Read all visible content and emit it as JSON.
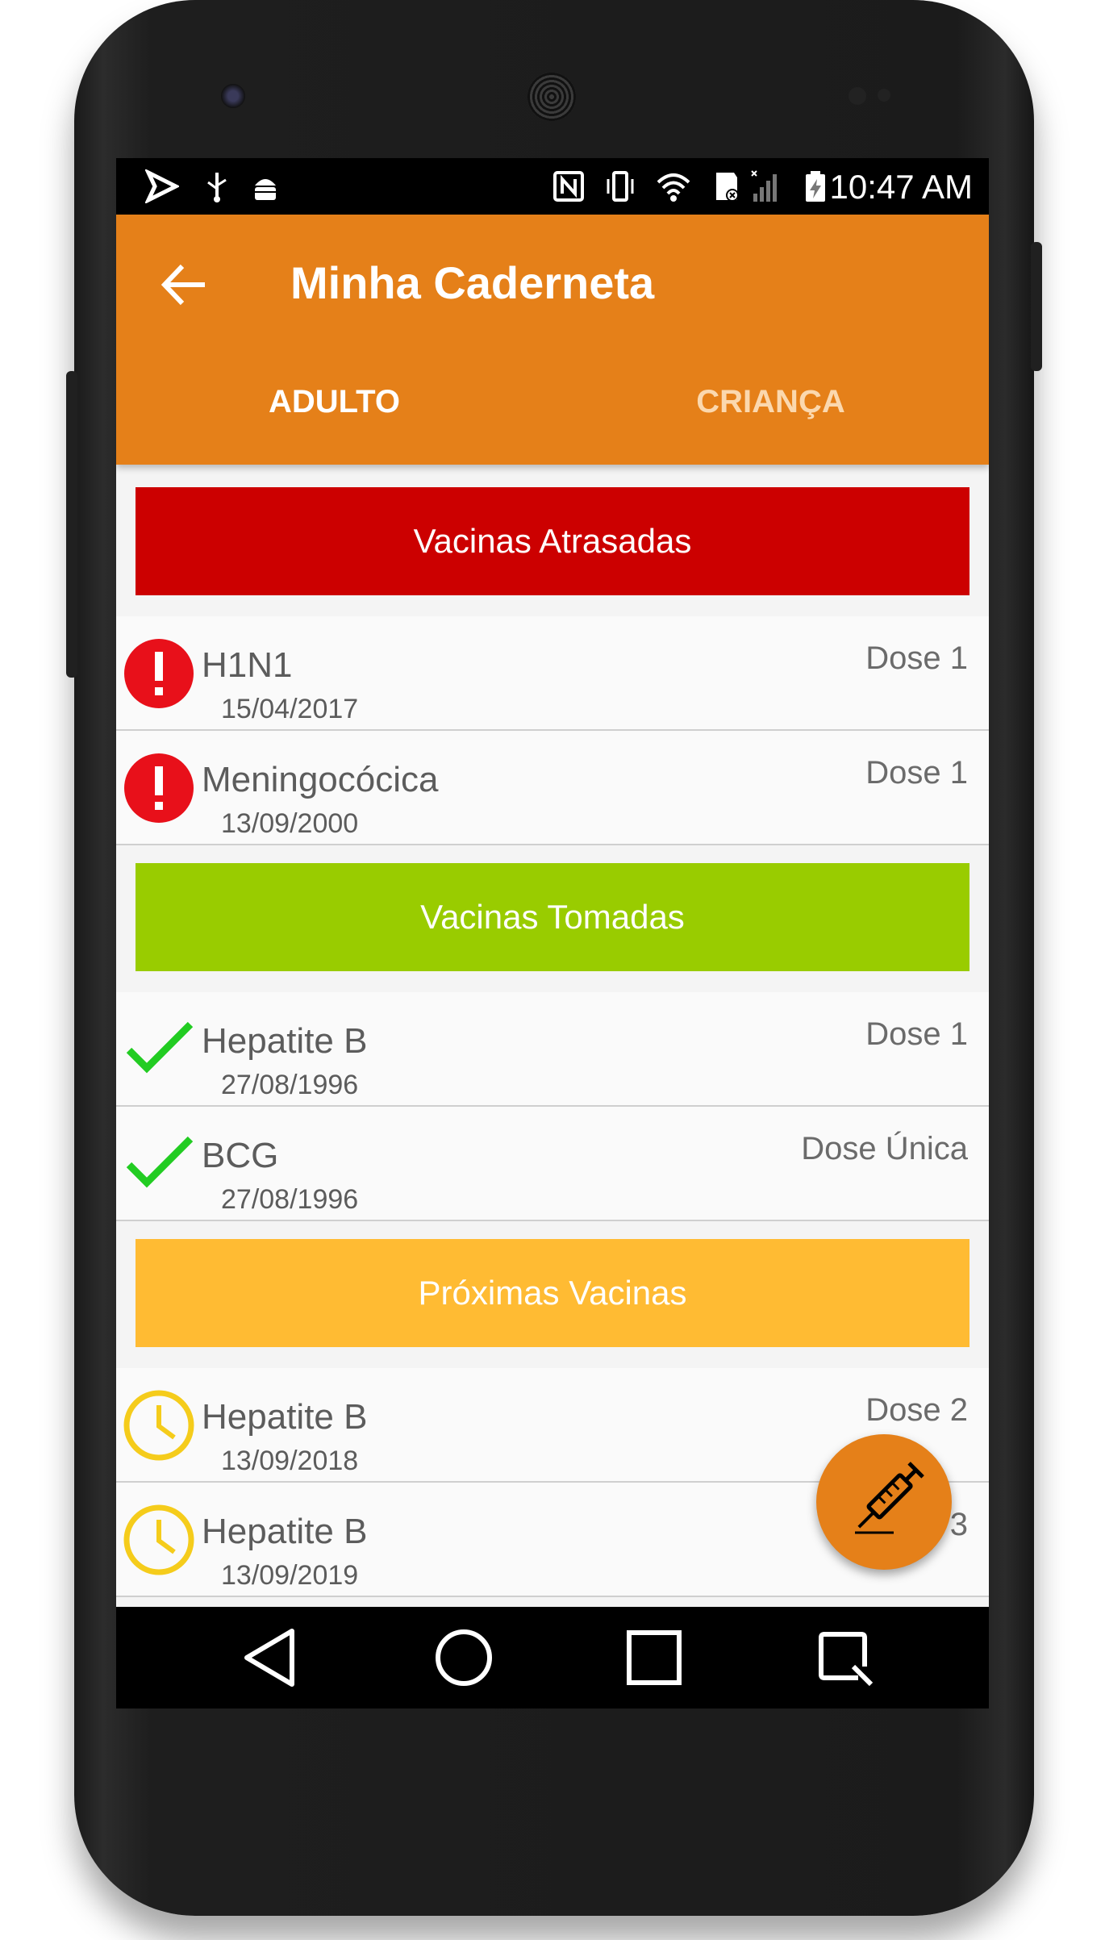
{
  "status_bar": {
    "time": "10:47 AM",
    "left_icons": [
      "play-store-icon",
      "usb-icon",
      "android-debug-icon"
    ],
    "right_icons": [
      "nfc-icon",
      "vibrate-icon",
      "wifi-icon",
      "sd-card-icon",
      "signal-icon",
      "battery-charging-icon"
    ]
  },
  "app_bar": {
    "title": "Minha Caderneta",
    "back_icon": "arrow-back-icon",
    "tabs": [
      {
        "label": "ADULTO",
        "active": true
      },
      {
        "label": "CRIANÇA",
        "active": false
      }
    ]
  },
  "sections": [
    {
      "title": "Vacinas Atrasadas",
      "color": "#cc0000",
      "icon": "alert-icon",
      "items": [
        {
          "name": "H1N1",
          "date": "15/04/2017",
          "dose": "Dose 1"
        },
        {
          "name": "Meningocócica",
          "date": "13/09/2000",
          "dose": "Dose 1"
        }
      ]
    },
    {
      "title": "Vacinas Tomadas",
      "color": "#99cc00",
      "icon": "check-icon",
      "items": [
        {
          "name": "Hepatite B",
          "date": "27/08/1996",
          "dose": "Dose 1"
        },
        {
          "name": "BCG",
          "date": "27/08/1996",
          "dose": "Dose Única"
        }
      ]
    },
    {
      "title": "Próximas Vacinas",
      "color": "#ffbb33",
      "icon": "clock-icon",
      "items": [
        {
          "name": "Hepatite B",
          "date": "13/09/2018",
          "dose": "Dose 2"
        },
        {
          "name": "Hepatite B",
          "date": "13/09/2019",
          "dose": "3"
        }
      ]
    }
  ],
  "fab": {
    "icon": "syringe-icon",
    "color": "#e58019"
  },
  "nav_bar": {
    "buttons": [
      "back-triangle-icon",
      "home-circle-icon",
      "recents-square-icon",
      "screenshot-icon"
    ]
  },
  "colors": {
    "accent": "#e58019",
    "alert_red": "#e8101a",
    "check_green": "#22cc22",
    "clock_yellow": "#f5cc1b"
  }
}
